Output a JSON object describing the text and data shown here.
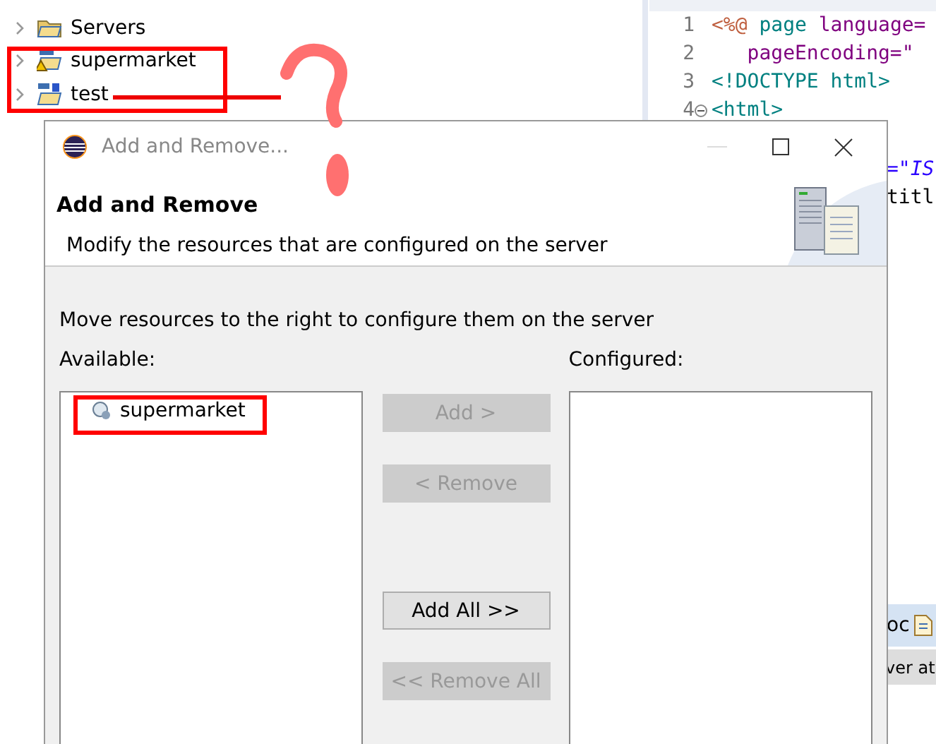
{
  "project_tree": [
    {
      "label": "Servers",
      "kind": "folder",
      "expanded": false
    },
    {
      "label": "supermarket",
      "kind": "warning",
      "expanded": false
    },
    {
      "label": "test",
      "kind": "web",
      "expanded": false
    }
  ],
  "editor": {
    "lines": [
      {
        "number": "1",
        "fold": false,
        "parts": [
          {
            "text": "<%@ ",
            "kind": "directive"
          },
          {
            "text": "page ",
            "kind": "tag"
          },
          {
            "text": "language=",
            "kind": "attr"
          }
        ]
      },
      {
        "number": "2",
        "fold": false,
        "parts": [
          {
            "text": "   pageEncoding=\"",
            "kind": "attr"
          }
        ]
      },
      {
        "number": "3",
        "fold": false,
        "parts": [
          {
            "text": "<!DOCTYPE html>",
            "kind": "tag"
          }
        ]
      },
      {
        "number": "4",
        "fold": true,
        "parts": [
          {
            "text": "<html>",
            "kind": "tag"
          }
        ]
      }
    ],
    "visible_fragments": [
      "=\"IS",
      "titl"
    ]
  },
  "bottom_tab": {
    "label": "oc"
  },
  "console_fragment": "ver at",
  "dialog": {
    "title": "Add and Remove...",
    "heading": "Add and Remove",
    "description": "Modify the resources that are configured on the server",
    "instruction": "Move resources to the right to configure them on the server",
    "available": {
      "label": "Available:",
      "items": [
        {
          "label": "supermarket"
        }
      ]
    },
    "configured": {
      "label": "Configured:"
    },
    "buttons": [
      {
        "label": "Add >",
        "disabled": true
      },
      {
        "label": "< Remove",
        "disabled": true
      },
      {
        "label": "Add All >>",
        "disabled": false
      },
      {
        "label": "<< Remove All",
        "disabled": true
      }
    ]
  }
}
